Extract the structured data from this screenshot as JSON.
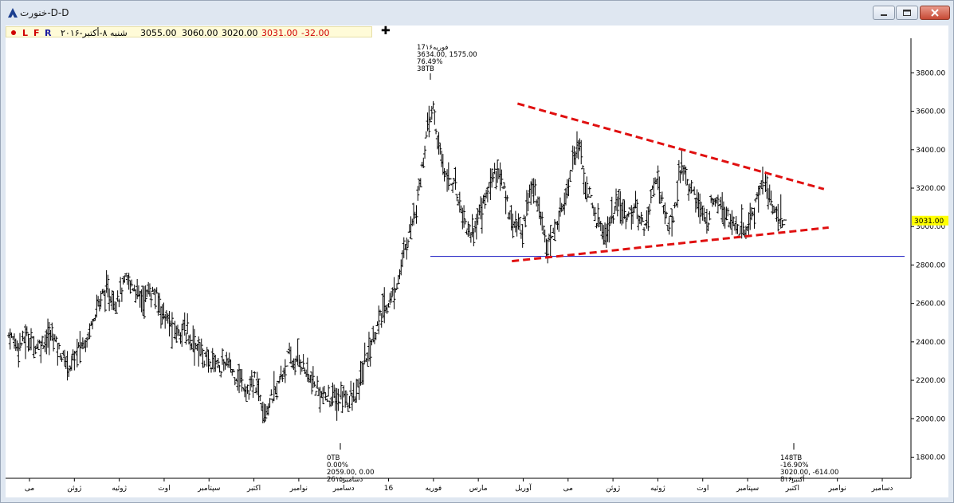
{
  "window": {
    "title": "خنورت-D-D"
  },
  "toolbar": {
    "buttons": [
      {
        "label": "L",
        "color": "#d00000"
      },
      {
        "label": "F",
        "color": "#d00000"
      },
      {
        "label": "R",
        "color": "#1a1aa0"
      }
    ],
    "date": "شنبه ۸-أکتبر-۲۰۱۶",
    "open": "3055.00",
    "high": "3060.00",
    "low": "3020.00",
    "close": "3031.00",
    "change": "-32.00"
  },
  "chart_data": {
    "type": "ohlc-bar",
    "y_ticks": [
      1800,
      2000,
      2200,
      2400,
      2600,
      2800,
      3000,
      3200,
      3400,
      3600,
      3800
    ],
    "y_tick_labels": [
      "1800.00",
      "2000.00",
      "2200.00",
      "2400.00",
      "2600.00",
      "2800.00",
      "3000.00",
      "3200.00",
      "3400.00",
      "3600.00",
      "3800.00"
    ],
    "ylim": [
      1690,
      3980
    ],
    "x_labels": [
      "می",
      "ژوئن",
      "ژوئیه",
      "اوت",
      "سپتامبر",
      "اکتبر",
      "نوامبر",
      "دسامبر",
      "16",
      "فوریه",
      "مارس",
      "آوریل",
      "می",
      "ژوئن",
      "ژوئیه",
      "اوت",
      "سپتامبر",
      "اکتبر",
      "نوامبر",
      "دسامبر"
    ],
    "last_price": "3031.00",
    "last_price_value": 3031,
    "price_series": [
      2440,
      2400,
      2390,
      2420,
      2410,
      2380,
      2395,
      2420,
      2440,
      2360,
      2300,
      2270,
      2340,
      2380,
      2420,
      2520,
      2600,
      2660,
      2640,
      2610,
      2660,
      2720,
      2700,
      2660,
      2620,
      2660,
      2650,
      2600,
      2530,
      2480,
      2450,
      2470,
      2440,
      2400,
      2370,
      2320,
      2280,
      2310,
      2260,
      2300,
      2250,
      2220,
      2180,
      2130,
      2200,
      2120,
      2050,
      2100,
      2160,
      2230,
      2320,
      2280,
      2310,
      2260,
      2200,
      2150,
      2130,
      2100,
      2110,
      2090,
      2120,
      2095,
      2110,
      2200,
      2320,
      2400,
      2480,
      2560,
      2600,
      2660,
      2760,
      2880,
      3000,
      3120,
      3300,
      3500,
      3620,
      3400,
      3300,
      3250,
      3200,
      3100,
      3000,
      2960,
      3050,
      3120,
      3200,
      3300,
      3260,
      3150,
      3050,
      3000,
      2980,
      3150,
      3200,
      3100,
      2950,
      2920,
      3000,
      3100,
      3200,
      3350,
      3450,
      3250,
      3150,
      3050,
      3000,
      2950,
      3050,
      3100,
      3080,
      3060,
      3100,
      3050,
      3000,
      3150,
      3250,
      3150,
      3000,
      3050,
      3250,
      3300,
      3200,
      3150,
      3080,
      3000,
      3150,
      3150,
      3100,
      3050,
      3000,
      2970,
      2980,
      3050,
      3150,
      3250,
      3180,
      3080,
      3040,
      3031
    ],
    "annotations": [
      {
        "lines": [
          "17فوریه۱۶",
          "3634.00, 1575.00",
          "76.49%",
          "38TB"
        ]
      },
      {
        "lines": [
          "0TB",
          "0.00%",
          "2059.00, 0.00",
          "26دسامبر۱۵"
        ]
      },
      {
        "lines": [
          "148TB",
          "-16.90%",
          "3020.00, -614.00",
          "8أکتبر۱۶"
        ]
      }
    ],
    "support_level": 2845,
    "trendline_upper": {
      "from": [
        0.543,
        3640
      ],
      "to": [
        0.868,
        3195
      ]
    },
    "trendline_lower": {
      "from": [
        0.537,
        2820
      ],
      "to": [
        0.873,
        2995
      ]
    },
    "colors": {
      "bars": "#000000",
      "trendline": "#e01010",
      "support": "#1010c0",
      "last_price_bg": "#ffff00"
    }
  }
}
